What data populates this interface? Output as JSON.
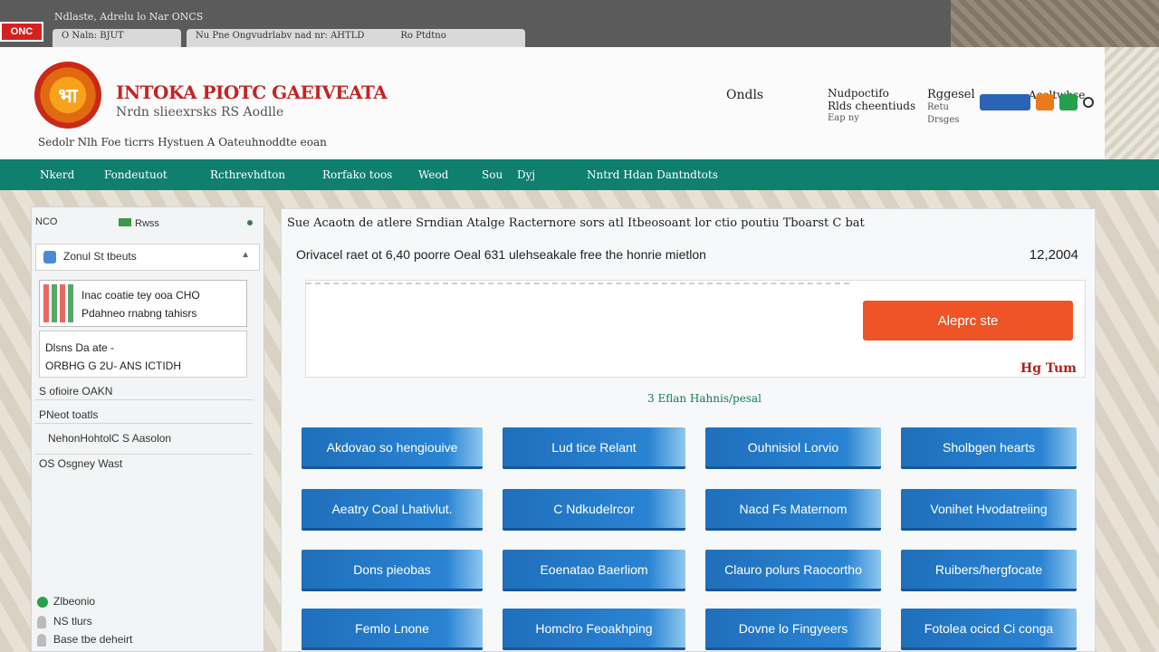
{
  "topbar": {
    "breadcrumb": "Ndlaste, Adrelu lo Nar ONCS",
    "logo_tab": "ONC",
    "tabs": [
      "O Naln: BJUT",
      "Nu Pne Ongvudrlabv nad nr: AHTLD",
      "Ro Ptdtno"
    ]
  },
  "header": {
    "emblem": "भा",
    "title": "INTOKA PIOTC GAEIVEATA",
    "subtitle": "Nrdn slieexrsks RS Aodlle",
    "tagline": "Sedolr Nlh Foe ticrrs Hystuen A Oateuhnoddte eoan",
    "links": [
      {
        "line1": "Ondls",
        "line2": ""
      },
      {
        "line1": "Nudpoctifo",
        "line2": "Rlds cheentiuds",
        "line3": "Eap ny"
      },
      {
        "line1": "Rggesel",
        "line2": "Retu",
        "line3": "Drsges"
      },
      {
        "line1": "Aceltwhse",
        "line2": ""
      }
    ]
  },
  "nav": {
    "items": [
      "Nkerd",
      "Fondeutuot",
      "Rcthrevhdton",
      "Rorfako toos",
      "Weod",
      "Sou",
      "Dyj",
      "Nntrd Hdan Dantndtots"
    ]
  },
  "sidebar": {
    "head_num": "NCO",
    "head_label": "Rwss",
    "select_label": "Zonul St tbeuts",
    "card1_line1": "Inac coatie tey ooa CHO",
    "card1_line2": "Pdahneo rnabng tahisrs",
    "card2_line1": "Dlsns Da ate -",
    "card2_line2": "ORBHG G 2U- ANS ICTIDH",
    "row1": "S ofioire OAKN",
    "row2": "PNeot toatls",
    "row3": "NehonHohtolC S Aasolon",
    "row4": "OS Osgney Wast",
    "bottom1": "Zlbeonio",
    "bottom2": "NS tlurs",
    "bottom3": "Base tbe deheirt"
  },
  "main": {
    "breadcrumb": "Sue Acaotn de atlere Srndian Atalge Racternore sors atl Itbeosoant lor ctio poutiu Tboarst C bat",
    "subline": "Orivacel raet ot 6,40 poorre Oeal 631 ulehseakale free the honrie mietlon",
    "code": "12,2004",
    "apply_button": "Aleprc ste",
    "hint": "Hg Tum",
    "count": "3 Eflan Hahnis/pesal",
    "services": [
      [
        "Akdovao so hengiouive",
        "Lud tice Relant",
        "Ouhnisiol Lorvio",
        "Sholbgen hearts"
      ],
      [
        "Aeatry Coal Lhativlut.",
        "C Ndkudelrcor",
        "Nacd Fs Maternom",
        "Vonihet Hvodatreiing"
      ],
      [
        "Dons pieobas",
        "Eoenatao Baerliom",
        "Clauro polurs Raocortho",
        "Ruibers/hergfocate"
      ],
      [
        "Femlo Lnone",
        "Homclro Feoakhping",
        "Dovne lo Fingyeers",
        "Fotolea ocicd Ci conga"
      ]
    ]
  },
  "colors": {
    "nav_green": "#0f7f6e",
    "title_red": "#c42424",
    "apply_orange": "#ee5426",
    "service_blue": "#1f6fbb"
  }
}
